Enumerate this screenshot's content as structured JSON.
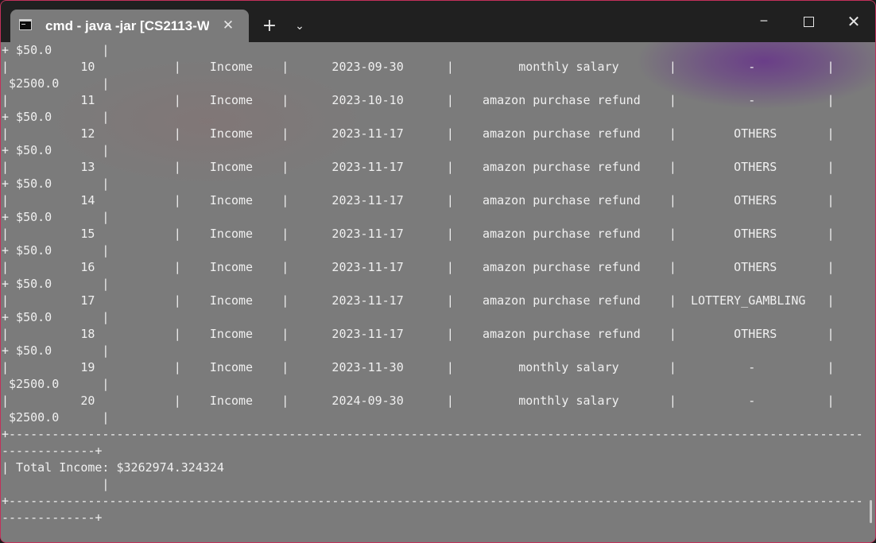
{
  "window": {
    "tab_title": "cmd - java  -jar [CS2113-W",
    "tab_icon": "terminal-icon",
    "newtab_glyph": "+",
    "dropdown_glyph": "⌄",
    "close_tab_glyph": "✕",
    "minimize_glyph": "─",
    "close_glyph": "✕",
    "accent_border": "#c2305a"
  },
  "terminal": {
    "lines": [
      "+ $50.0       |",
      "|          10           |    Income    |      2023-09-30      |         monthly salary       |          -          |       +",
      " $2500.0      |",
      "|          11           |    Income    |      2023-10-10      |    amazon purchase refund    |          -          |",
      "+ $50.0       |",
      "|          12           |    Income    |      2023-11-17      |    amazon purchase refund    |        OTHERS       |",
      "+ $50.0       |",
      "|          13           |    Income    |      2023-11-17      |    amazon purchase refund    |        OTHERS       |",
      "+ $50.0       |",
      "|          14           |    Income    |      2023-11-17      |    amazon purchase refund    |        OTHERS       |",
      "+ $50.0       |",
      "|          15           |    Income    |      2023-11-17      |    amazon purchase refund    |        OTHERS       |",
      "+ $50.0       |",
      "|          16           |    Income    |      2023-11-17      |    amazon purchase refund    |        OTHERS       |",
      "+ $50.0       |",
      "|          17           |    Income    |      2023-11-17      |    amazon purchase refund    |  LOTTERY_GAMBLING   |",
      "+ $50.0       |",
      "|          18           |    Income    |      2023-11-17      |    amazon purchase refund    |        OTHERS       |",
      "+ $50.0       |",
      "|          19           |    Income    |      2023-11-30      |         monthly salary       |          -          |       +",
      " $2500.0      |",
      "|          20           |    Income    |      2024-09-30      |         monthly salary       |          -          |       +",
      " $2500.0      |",
      "+-----------------------------------------------------------------------------------------------------------------------",
      "-------------+",
      "| Total Income: $3262974.324324",
      "              |",
      "+-----------------------------------------------------------------------------------------------------------------------",
      "-------------+"
    ]
  }
}
